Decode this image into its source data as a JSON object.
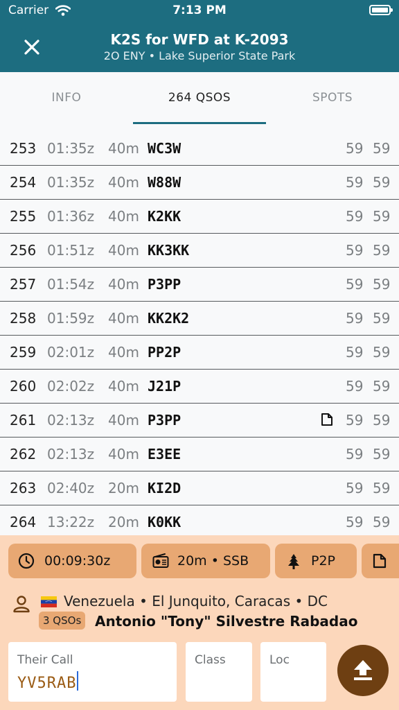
{
  "status": {
    "carrier": "Carrier",
    "time": "7:13 PM"
  },
  "header": {
    "title": "K2S for WFD at K-2093",
    "subtitle": "2O ENY • Lake Superior State Park"
  },
  "tabs": [
    {
      "label": "INFO"
    },
    {
      "label": "264 QSOS"
    },
    {
      "label": "SPOTS"
    }
  ],
  "qsos": [
    {
      "num": "253",
      "time": "01:35z",
      "band": "40m",
      "call": "WC3W",
      "sent": "59",
      "rcvd": "59"
    },
    {
      "num": "254",
      "time": "01:35z",
      "band": "40m",
      "call": "W88W",
      "sent": "59",
      "rcvd": "59"
    },
    {
      "num": "255",
      "time": "01:36z",
      "band": "40m",
      "call": "K2KK",
      "sent": "59",
      "rcvd": "59"
    },
    {
      "num": "256",
      "time": "01:51z",
      "band": "40m",
      "call": "KK3KK",
      "sent": "59",
      "rcvd": "59"
    },
    {
      "num": "257",
      "time": "01:54z",
      "band": "40m",
      "call": "P3PP",
      "sent": "59",
      "rcvd": "59"
    },
    {
      "num": "258",
      "time": "01:59z",
      "band": "40m",
      "call": "KK2K2",
      "sent": "59",
      "rcvd": "59"
    },
    {
      "num": "259",
      "time": "02:01z",
      "band": "40m",
      "call": "PP2P",
      "sent": "59",
      "rcvd": "59"
    },
    {
      "num": "260",
      "time": "02:02z",
      "band": "40m",
      "call": "J21P",
      "sent": "59",
      "rcvd": "59"
    },
    {
      "num": "261",
      "time": "02:13z",
      "band": "40m",
      "call": "P3PP",
      "sent": "59",
      "rcvd": "59",
      "has_note": true
    },
    {
      "num": "262",
      "time": "02:13z",
      "band": "40m",
      "call": "E3EE",
      "sent": "59",
      "rcvd": "59"
    },
    {
      "num": "263",
      "time": "02:40z",
      "band": "20m",
      "call": "KI2D",
      "sent": "59",
      "rcvd": "59"
    },
    {
      "num": "264",
      "time": "13:22z",
      "band": "20m",
      "call": "K0KK",
      "sent": "59",
      "rcvd": "59"
    }
  ],
  "chips": {
    "timer": "00:09:30z",
    "radio": "20m • SSB",
    "p2p": "P2P"
  },
  "station": {
    "location": "Venezuela • El Junquito, Caracas • DC",
    "qso_badge": "3 QSOs",
    "name": "Antonio \"Tony\" Silvestre Rabadao"
  },
  "form": {
    "their_call_label": "Their Call",
    "their_call_value": "YV5RAB",
    "class_label": "Class",
    "loc_label": "Loc"
  },
  "colors": {
    "header_bg": "#1d6d80",
    "panel_bg": "#fcd7bb",
    "chip_bg": "#e8a873",
    "upload_bg": "#6e3f12"
  }
}
